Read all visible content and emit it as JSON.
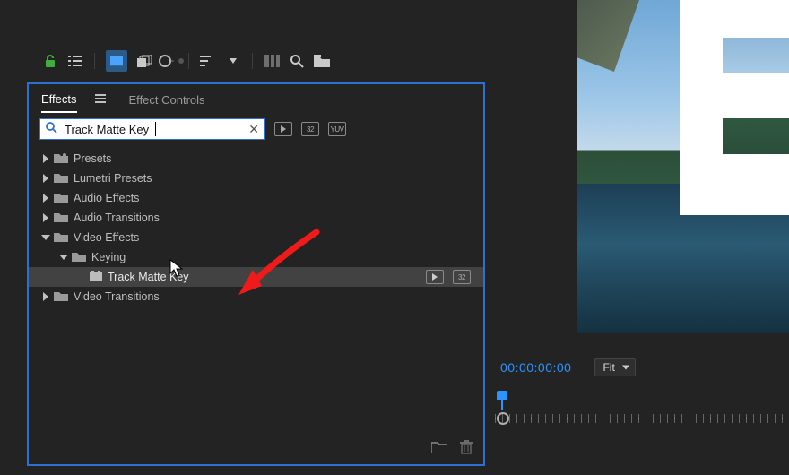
{
  "panel": {
    "tabs": {
      "effects": "Effects",
      "controls": "Effect Controls"
    },
    "search_value": "Track Matte Key",
    "tree": {
      "presets": "Presets",
      "lumetri": "Lumetri Presets",
      "audio_effects": "Audio Effects",
      "audio_transitions": "Audio Transitions",
      "video_effects": "Video Effects",
      "keying": "Keying",
      "track_matte_key": "Track Matte Key",
      "video_transitions": "Video Transitions"
    },
    "badges": {
      "b32": "32",
      "byuv": "YUV"
    }
  },
  "program": {
    "timecode": "00:00:00:00",
    "fit_label": "Fit"
  }
}
